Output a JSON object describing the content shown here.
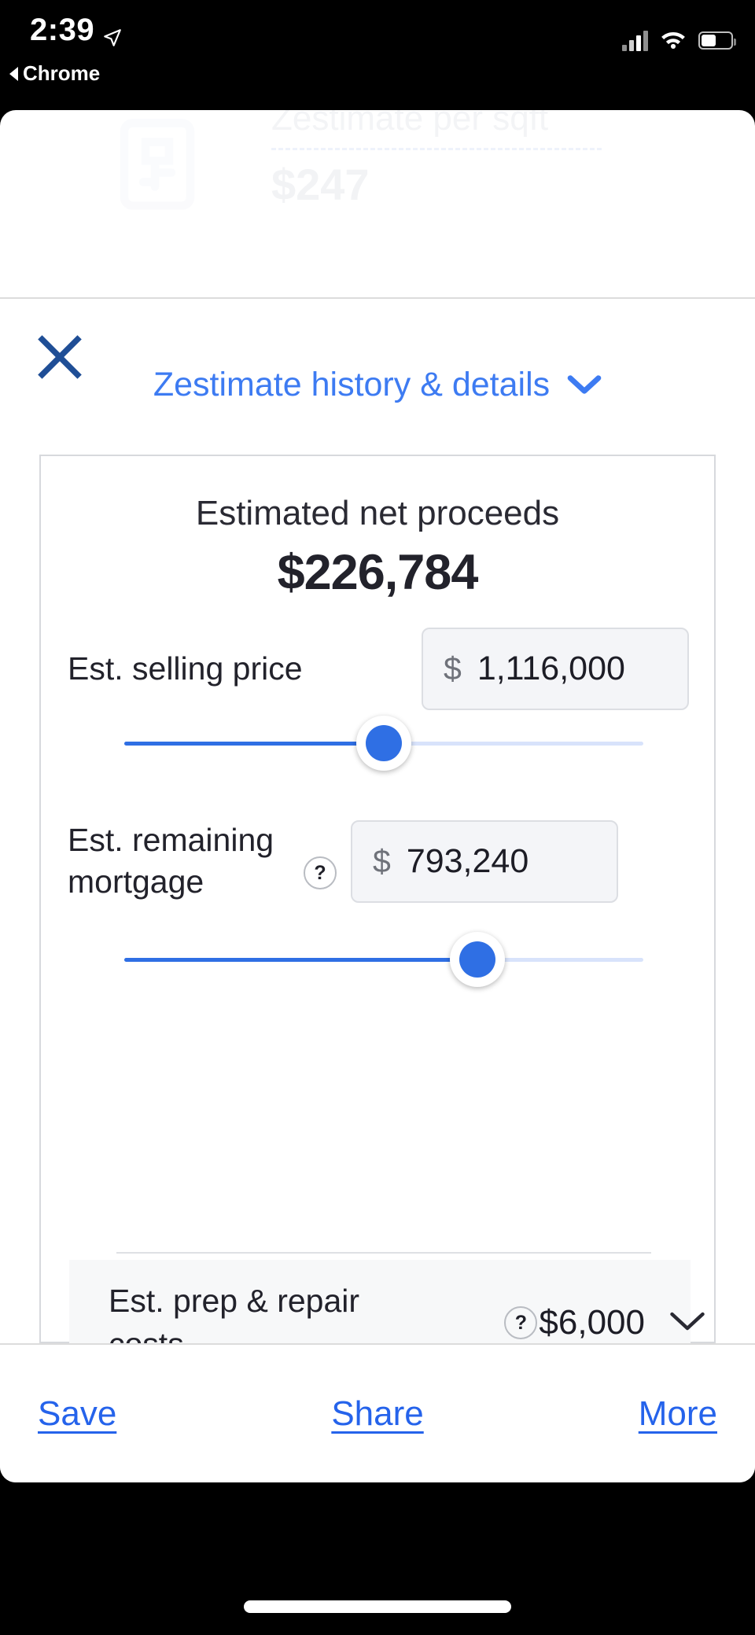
{
  "status_bar": {
    "time": "2:39",
    "back_app": "Chrome",
    "location_icon": "location-arrow-icon",
    "signal_icon": "cellular-signal-icon",
    "wifi_icon": "wifi-icon",
    "battery_icon": "battery-icon"
  },
  "background_faded": {
    "label": "Zestimate per sqft",
    "value": "$247",
    "house_icon": "house-outline-icon"
  },
  "header": {
    "close_icon": "close-icon"
  },
  "zestimate_link": {
    "label": "Zestimate history & details",
    "chevron_icon": "chevron-down-icon"
  },
  "card": {
    "title": "Estimated net proceeds",
    "amount": "$226,784",
    "rows": [
      {
        "label": "Est. selling price",
        "currency_symbol": "$",
        "value": "1,116,000",
        "slider_percent": 50
      },
      {
        "label_line1": "Est. remaining",
        "label_line2": "mortgage",
        "help_icon": "question-mark-icon",
        "currency_symbol": "$",
        "value": "793,240",
        "slider_percent": 68
      }
    ],
    "prep_row": {
      "label_line1": "Est. prep & repair",
      "label_line2": "costs",
      "help_icon": "question-mark-icon",
      "amount": "$6,000",
      "chevron_icon": "chevron-down-icon"
    }
  },
  "action_bar": {
    "save": "Save",
    "share": "Share",
    "more": "More"
  },
  "colors": {
    "link_blue": "#3d7bf2",
    "action_blue": "#2563eb",
    "slider_blue": "#2f6fe4",
    "close_blue": "#1f4e96",
    "card_border": "#d7d9dd",
    "input_bg": "#f4f5f8"
  }
}
